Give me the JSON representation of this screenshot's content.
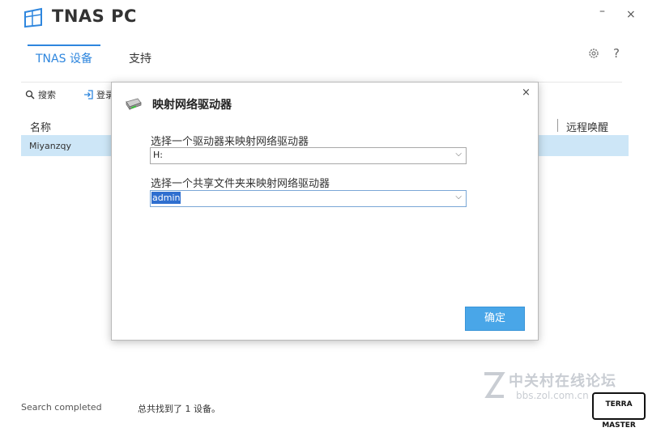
{
  "app": {
    "title": "TNAS PC"
  },
  "window": {
    "minimize_glyph": "–",
    "close_glyph": "×"
  },
  "tabs": [
    {
      "label": "TNAS 设备",
      "active": true
    },
    {
      "label": "支持",
      "active": false
    }
  ],
  "header_icons": {
    "settings": "gear-icon",
    "help_glyph": "?"
  },
  "toolbar": {
    "search_label": "搜索",
    "login_label": "登录"
  },
  "table": {
    "columns": [
      "名称",
      "远程唤醒"
    ],
    "rows": [
      {
        "name": "Miyanzqy",
        "selected": true
      }
    ]
  },
  "status": {
    "left": "Search completed",
    "right": "总共找到了 1  设备。"
  },
  "dialog": {
    "title": "映射网络驱动器",
    "close_glyph": "×",
    "drive_label": "选择一个驱动器来映射网络驱动器",
    "drive_value": "H:",
    "share_label": "选择一个共享文件夹来映射网络驱动器",
    "share_value": "admin",
    "ok_label": "确定"
  },
  "watermark": {
    "site_cn": "中关村在线论坛",
    "site_url": "bbs.zol.com.cn",
    "brand": "TERRA MASTER"
  },
  "colors": {
    "accent": "#2e86de",
    "button": "#49a6e8",
    "selection": "#cde6f7"
  }
}
